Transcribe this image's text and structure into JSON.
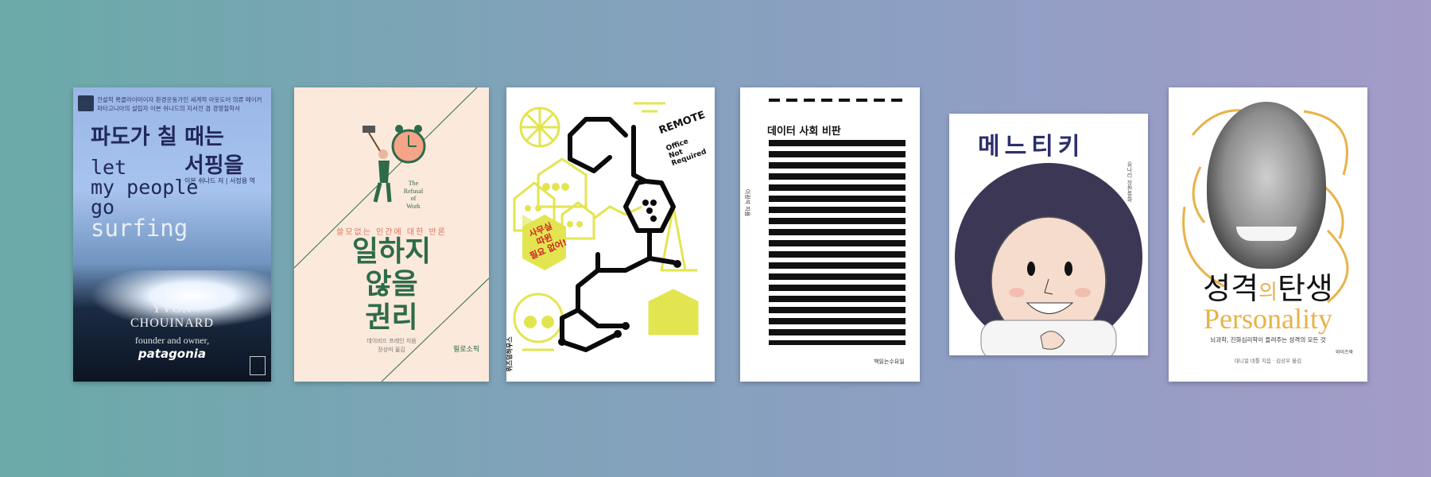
{
  "books": [
    {
      "title_kr_line1": "파도가 칠 때는",
      "title_kr_line2": "서핑을",
      "title_en": [
        "let",
        "my people",
        "go",
        "surfing"
      ],
      "author_en": "YVON",
      "author_en2": "CHOUINARD",
      "tagline": "founder and owner,",
      "brand": "patagonia",
      "blurb1": "전설적 록클라이머이자 환경운동가인 세계적 아웃도어 의류 메이커",
      "blurb2": "파타고니아의 설립자 이본 쉬나드의 지서전 겸 경영철학서",
      "author_kr": "이본 쉬나드 저 | 서정용 역"
    },
    {
      "en_title": [
        "The",
        "Refusal",
        "of",
        "Work"
      ],
      "subtitle": "쓸모없는 인간에 대한 반론",
      "title": [
        "일하지",
        "않을",
        "권리"
      ],
      "credit1": "데이비드 프레인 지음",
      "credit2": "장상미 옮김",
      "publisher": "필로소픽"
    },
    {
      "remote": "REMOTE",
      "remote_sub": [
        "Office",
        "Not",
        "Required"
      ],
      "badge": [
        "사무실",
        "따윈",
        "필요 없어!"
      ],
      "publisher": "위즈덤하우스"
    },
    {
      "title": "데이터 사회 비판",
      "spine": "이광석 지음",
      "publisher": "책읽는수요일"
    },
    {
      "title_glyphs": "메느티키",
      "side": "유나리 장편동화"
    },
    {
      "title_kr": [
        "성격",
        "의",
        "탄생"
      ],
      "title_en": "Personality",
      "subtitle": "뇌과학, 진화심리학이 들려주는 성격의 모든 것",
      "credit": "대니얼 네틀 지음 · 김상우 옮김",
      "publisher": "와이즈북"
    }
  ]
}
